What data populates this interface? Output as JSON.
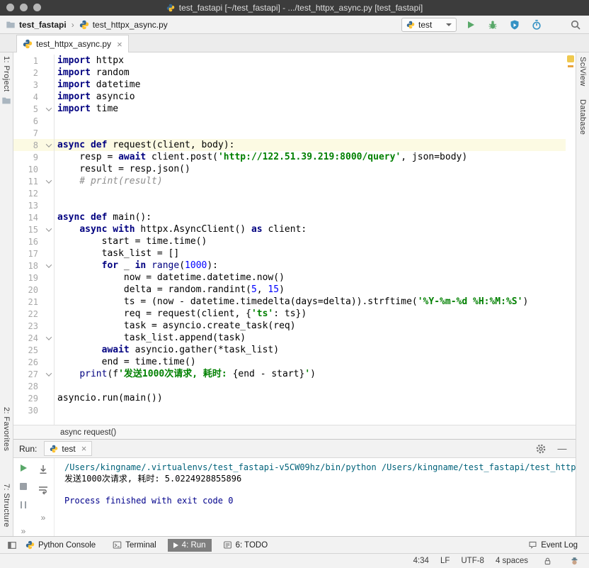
{
  "window": {
    "title": "test_fastapi [~/test_fastapi] - .../test_httpx_async.py [test_fastapi]"
  },
  "nav": {
    "project_crumb": "test_fastapi",
    "separator": "›",
    "file_crumb": "test_httpx_async.py",
    "run_config": "test"
  },
  "editor_tab": {
    "label": "test_httpx_async.py",
    "close": "×"
  },
  "tool_buttons": {
    "project": "1: Project",
    "favorites": "2: Favorites",
    "structure": "7: Structure",
    "sciview": "SciView",
    "database": "Database"
  },
  "editor": {
    "current_line": 8,
    "fold_lines": [
      5,
      8,
      11,
      15,
      18,
      24,
      27
    ],
    "breadcrumb": "async request()",
    "lines": [
      [
        [
          "kw",
          "import"
        ],
        [
          "pl",
          " httpx"
        ]
      ],
      [
        [
          "kw",
          "import"
        ],
        [
          "pl",
          " random"
        ]
      ],
      [
        [
          "kw",
          "import"
        ],
        [
          "pl",
          " datetime"
        ]
      ],
      [
        [
          "kw",
          "import"
        ],
        [
          "pl",
          " asyncio"
        ]
      ],
      [
        [
          "kw",
          "import"
        ],
        [
          "pl",
          " time"
        ]
      ],
      [],
      [],
      [
        [
          "kw",
          "async"
        ],
        [
          "pl",
          " "
        ],
        [
          "kw",
          "def"
        ],
        [
          "pl",
          " request(client, body):"
        ]
      ],
      [
        [
          "pl",
          "    resp = "
        ],
        [
          "kw",
          "await"
        ],
        [
          "pl",
          " client.post("
        ],
        [
          "str",
          "'http://122.51.39.219:8000/query'"
        ],
        [
          "pl",
          ", json=body)"
        ]
      ],
      [
        [
          "pl",
          "    result = resp.json()"
        ]
      ],
      [
        [
          "com",
          "    # print(result)"
        ]
      ],
      [],
      [],
      [
        [
          "kw",
          "async"
        ],
        [
          "pl",
          " "
        ],
        [
          "kw",
          "def"
        ],
        [
          "pl",
          " main():"
        ]
      ],
      [
        [
          "pl",
          "    "
        ],
        [
          "kw",
          "async"
        ],
        [
          "pl",
          " "
        ],
        [
          "kw",
          "with"
        ],
        [
          "pl",
          " httpx.AsyncClient() "
        ],
        [
          "kw",
          "as"
        ],
        [
          "pl",
          " client:"
        ]
      ],
      [
        [
          "pl",
          "        start = time.time()"
        ]
      ],
      [
        [
          "pl",
          "        task_list = []"
        ]
      ],
      [
        [
          "pl",
          "        "
        ],
        [
          "kw",
          "for"
        ],
        [
          "pl",
          " _ "
        ],
        [
          "kw",
          "in"
        ],
        [
          "pl",
          " "
        ],
        [
          "bi",
          "range"
        ],
        [
          "pl",
          "("
        ],
        [
          "num",
          "1000"
        ],
        [
          "pl",
          "):"
        ]
      ],
      [
        [
          "pl",
          "            now = datetime.datetime.now()"
        ]
      ],
      [
        [
          "pl",
          "            delta = random.randint("
        ],
        [
          "num",
          "5"
        ],
        [
          "pl",
          ", "
        ],
        [
          "num",
          "15"
        ],
        [
          "pl",
          ")"
        ]
      ],
      [
        [
          "pl",
          "            ts = (now - datetime.timedelta(days=delta)).strftime("
        ],
        [
          "str",
          "'%Y-%m-%d %H:%M:%S'"
        ],
        [
          "pl",
          ")"
        ]
      ],
      [
        [
          "pl",
          "            req = request(client, {"
        ],
        [
          "str",
          "'ts'"
        ],
        [
          "pl",
          ": ts})"
        ]
      ],
      [
        [
          "pl",
          "            task = asyncio.create_task(req)"
        ]
      ],
      [
        [
          "pl",
          "            task_list.append(task)"
        ]
      ],
      [
        [
          "pl",
          "        "
        ],
        [
          "kw",
          "await"
        ],
        [
          "pl",
          " asyncio.gather(*task_list)"
        ]
      ],
      [
        [
          "pl",
          "        end = time.time()"
        ]
      ],
      [
        [
          "pl",
          "    "
        ],
        [
          "bi",
          "print"
        ],
        [
          "pl",
          "(f"
        ],
        [
          "str",
          "'发送1000次请求, 耗时: "
        ],
        [
          "pl",
          "{end - start}"
        ],
        [
          "str",
          "'"
        ],
        [
          "pl",
          ")"
        ]
      ],
      [],
      [
        [
          "pl",
          "asyncio.run(main())"
        ]
      ],
      []
    ]
  },
  "run_panel": {
    "label": "Run:",
    "tab_label": "test",
    "tab_close": "×",
    "minimize": "—",
    "overflow": "»",
    "console": [
      {
        "cls": "cmd",
        "text": "/Users/kingname/.virtualenvs/test_fastapi-v5CW09hz/bin/python /Users/kingname/test_fastapi/test_httpx_a"
      },
      {
        "cls": "out",
        "text": "发送1000次请求, 耗时: 5.0224928855896"
      },
      {
        "cls": "out",
        "text": ""
      },
      {
        "cls": "sys",
        "text": "Process finished with exit code 0"
      }
    ]
  },
  "bottom_bar": {
    "python_console": "Python Console",
    "terminal": "Terminal",
    "run": "4: Run",
    "todo": "6: TODO",
    "event_log": "Event Log"
  },
  "status_bar": {
    "position": "4:34",
    "line_ending": "LF",
    "encoding": "UTF-8",
    "indent": "4 spaces"
  },
  "colors": {
    "run_green": "#59A869",
    "keyword": "#000080",
    "string": "#008000",
    "number": "#0000FF",
    "comment": "#8C8C8C",
    "current_line_bg": "#FCFAE3",
    "console_command": "#00627A",
    "console_system": "#00008B"
  }
}
